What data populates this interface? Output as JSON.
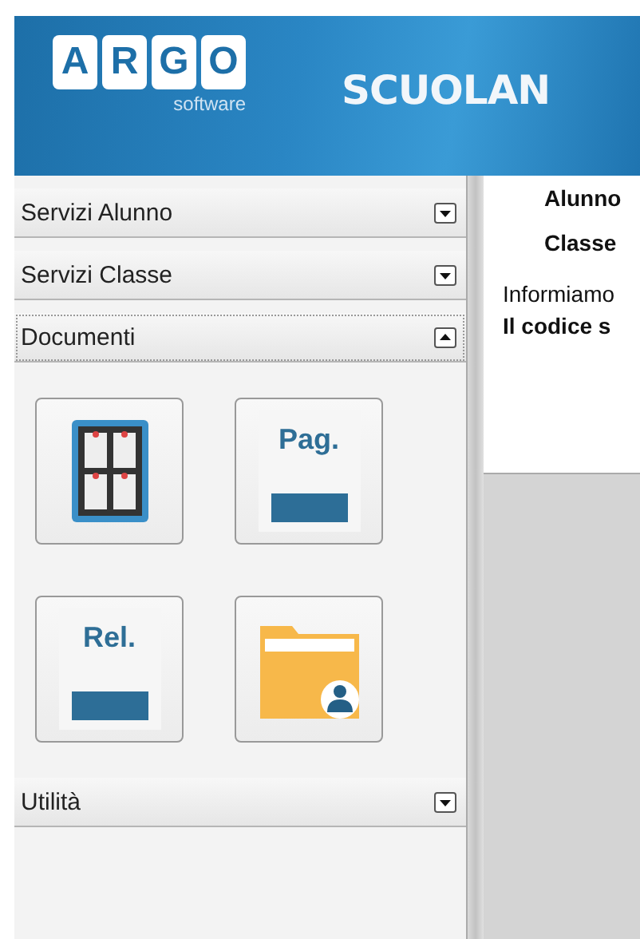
{
  "header": {
    "logo_letters": [
      "A",
      "R",
      "G",
      "O"
    ],
    "logo_subtitle": "software",
    "title": "SCUOLAN"
  },
  "sidebar": {
    "sections": [
      {
        "label": "Servizi Alunno",
        "expanded": false
      },
      {
        "label": "Servizi Classe",
        "expanded": false
      },
      {
        "label": "Documenti",
        "expanded": true,
        "tiles": [
          {
            "kind": "board"
          },
          {
            "kind": "page",
            "label": "Pag."
          },
          {
            "kind": "page",
            "label": "Rel."
          },
          {
            "kind": "folder"
          }
        ]
      },
      {
        "label": "Utilità",
        "expanded": false
      }
    ]
  },
  "content": {
    "fields": [
      "Alunno",
      "Classe"
    ],
    "message": "Informiamo",
    "notice": "Il codice s"
  }
}
